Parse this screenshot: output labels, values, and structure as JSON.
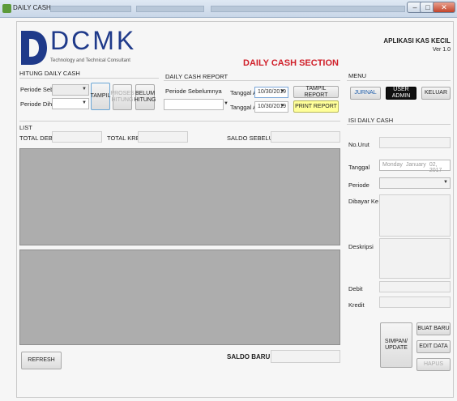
{
  "window": {
    "title": "DAILY CASH",
    "min": "–",
    "max": "□",
    "close": "✕"
  },
  "header": {
    "logo_letter": "D",
    "logo_text": "DCMK",
    "logo_subtitle": "Technology and Technical Consultant",
    "app_title": "APLIKASI KAS KECIL",
    "version": "Ver 1.0",
    "section_title": "DAILY CASH SECTION",
    "brand_color": "#1f3a8a",
    "accent_color": "#d0202a"
  },
  "hitung": {
    "heading": "HITUNG DAILY CASH",
    "periode_sebelum_label": "Periode Sebelum",
    "periode_dihitung_label": "Periode Dihitung",
    "tampil": "TAMPIL",
    "proses_hitung": "PROSES HITUNG",
    "belum_hitung": "BELUM HITUNG"
  },
  "report": {
    "heading": "DAILY CASH REPORT",
    "periode_label": "Periode Sebelumnya",
    "tanggal_awal_label": "Tanggal Awal",
    "tanggal_awal": "10/30/2019",
    "tanggal_akhir_label": "Tanggal Akhir",
    "tanggal_akhir": "10/30/2019",
    "tampil_report": "TAMPIL REPORT",
    "print_report": "PRINT REPORT",
    "print_color": "#ffff99"
  },
  "list": {
    "heading": "LIST",
    "total_debit": "TOTAL DEBIT",
    "total_kredit": "TOTAL KREDIT",
    "saldo_sebelumnya": "SALDO SEBELUMNYA",
    "refresh": "REFRESH",
    "saldo_baru": "SALDO BARU"
  },
  "menu": {
    "heading": "MENU",
    "jurnal": "JURNAL",
    "user_admin": "USER ADMIN",
    "keluar": "KELUAR"
  },
  "isi": {
    "heading": "ISI DAILY CASH",
    "no_urut": "No.Urut",
    "tanggal": "Tanggal",
    "tanggal_value_day": "Monday",
    "tanggal_value_month": "January",
    "tanggal_value_date": "02, 2017",
    "periode": "Periode",
    "dibayar_ke": "Dibayar Ke",
    "deskripsi": "Deskripsi",
    "debit": "Debit",
    "kredit": "Kredit",
    "simpan_update": "SIMPAN/ UPDATE",
    "buat_baru": "BUAT BARU",
    "edit_data": "EDIT DATA",
    "hapus": "HAPUS"
  }
}
